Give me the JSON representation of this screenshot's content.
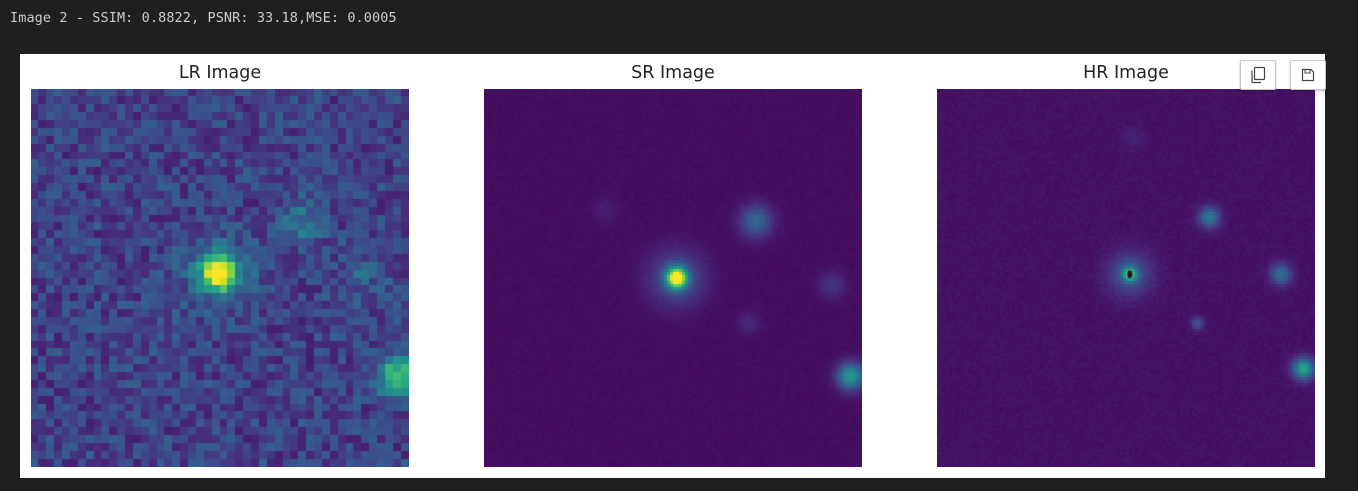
{
  "output": {
    "stdout_line": "Image 2 - SSIM: 0.8822, PSNR: 33.18,MSE: 0.0005"
  },
  "figure": {
    "panels": [
      {
        "title": "LR Image"
      },
      {
        "title": "SR Image"
      },
      {
        "title": "HR Image"
      }
    ],
    "colormap": "viridis"
  },
  "toolbar": {
    "copy_icon": "copy-icon",
    "save_icon": "save-icon"
  }
}
